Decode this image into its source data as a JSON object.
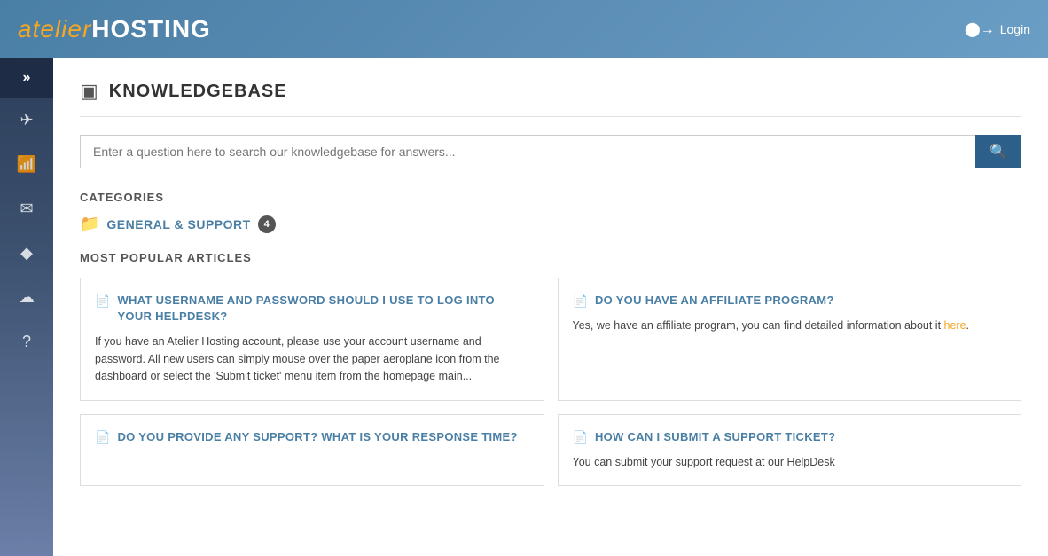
{
  "header": {
    "logo_italic": "atelier",
    "logo_bold": "HOSTING",
    "login_label": "Login"
  },
  "sidebar": {
    "toggle_icon": "»",
    "items": [
      {
        "name": "rocket",
        "icon": "🚀"
      },
      {
        "name": "feed",
        "icon": "📡"
      },
      {
        "name": "mail",
        "icon": "✉"
      },
      {
        "name": "diamond",
        "icon": "💎"
      },
      {
        "name": "cloud",
        "icon": "☁"
      },
      {
        "name": "help",
        "icon": "?"
      }
    ]
  },
  "page": {
    "title": "KNOWLEDGEBASE",
    "title_icon": "📋",
    "search_placeholder": "Enter a question here to search our knowledgebase for answers...",
    "search_button_icon": "🔍",
    "categories_label": "CATEGORIES",
    "category": {
      "icon": "📁",
      "label": "GENERAL & SUPPORT",
      "count": "4"
    },
    "popular_label": "MOST POPULAR ARTICLES",
    "articles": [
      {
        "title": "WHAT USERNAME AND PASSWORD SHOULD I USE TO LOG INTO YOUR HELPDESK?",
        "excerpt": "If you have an Atelier Hosting account, please use your account username and password. All new users can simply mouse over the paper aeroplane icon from the dashboard or select the 'Submit ticket' menu item from the homepage main..."
      },
      {
        "title": "DO YOU HAVE AN AFFILIATE PROGRAM?",
        "excerpt": "Yes, we have an affiliate program, you can find detailed information about it here."
      },
      {
        "title": "DO YOU PROVIDE ANY SUPPORT? WHAT IS YOUR RESPONSE TIME?",
        "excerpt": ""
      },
      {
        "title": "HOW CAN I SUBMIT A SUPPORT TICKET?",
        "excerpt": "You can submit your support request at our HelpDesk"
      }
    ]
  }
}
